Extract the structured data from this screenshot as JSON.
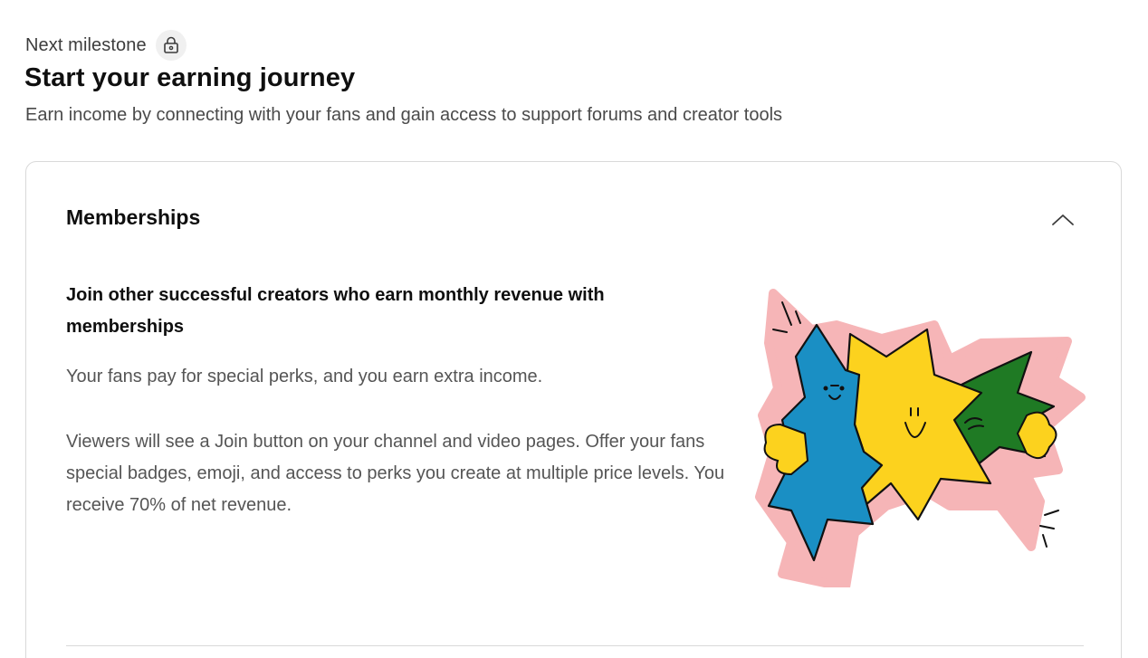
{
  "header": {
    "milestone_label": "Next milestone",
    "milestone_icon": "lock-icon",
    "title": "Start your earning journey",
    "subtitle": "Earn income by connecting with your fans and gain access to support forums and creator tools"
  },
  "card": {
    "title": "Memberships",
    "toggle_icon": "chevron-up-icon",
    "headline": "Join other successful creators who earn monthly revenue with memberships",
    "paragraph1": "Your fans pay for special perks, and you earn extra income.",
    "paragraph2": "Viewers will see a Join button on your channel and video pages. Offer your fans special badges, emoji, and access to perks you create at multiple price levels. You receive 70% of net revenue.",
    "illustration": "memberships-illustration"
  },
  "colors": {
    "blue": "#1a8fc4",
    "yellow": "#fcd21e",
    "green": "#1f7a24",
    "pink_outline": "#f6b5b7",
    "text_primary": "#0f0f0f",
    "text_secondary": "#555555"
  }
}
